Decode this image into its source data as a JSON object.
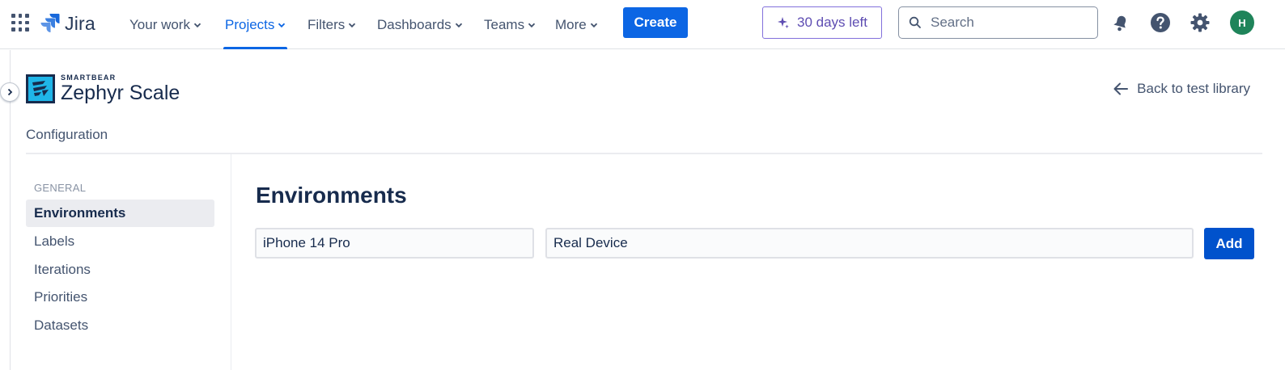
{
  "topnav": {
    "logo_text": "Jira",
    "items": [
      {
        "label": "Your work",
        "active": false
      },
      {
        "label": "Projects",
        "active": true
      },
      {
        "label": "Filters",
        "active": false
      },
      {
        "label": "Dashboards",
        "active": false
      },
      {
        "label": "Teams",
        "active": false
      },
      {
        "label": "More",
        "active": false
      }
    ],
    "create_label": "Create",
    "trial_label": "30 days left",
    "search_placeholder": "Search",
    "avatar_initial": "H",
    "icons": [
      "app-switcher-icon",
      "notifications-icon",
      "help-icon",
      "settings-icon"
    ],
    "accent_color": "#0c66e4",
    "trial_color": "#5e4db2",
    "avatar_color": "#1f845a"
  },
  "app": {
    "brand_small": "SMARTBEAR",
    "brand_name": "Zephyr Scale",
    "back_link": "Back to test library",
    "section_title": "Configuration"
  },
  "sidebar": {
    "group_label": "GENERAL",
    "items": [
      {
        "label": "Environments",
        "selected": true
      },
      {
        "label": "Labels",
        "selected": false
      },
      {
        "label": "Iterations",
        "selected": false
      },
      {
        "label": "Priorities",
        "selected": false
      },
      {
        "label": "Datasets",
        "selected": false
      }
    ]
  },
  "main": {
    "title": "Environments",
    "name_value": "iPhone 14 Pro",
    "description_value": "Real Device",
    "add_label": "Add",
    "add_color": "#0052cc"
  }
}
